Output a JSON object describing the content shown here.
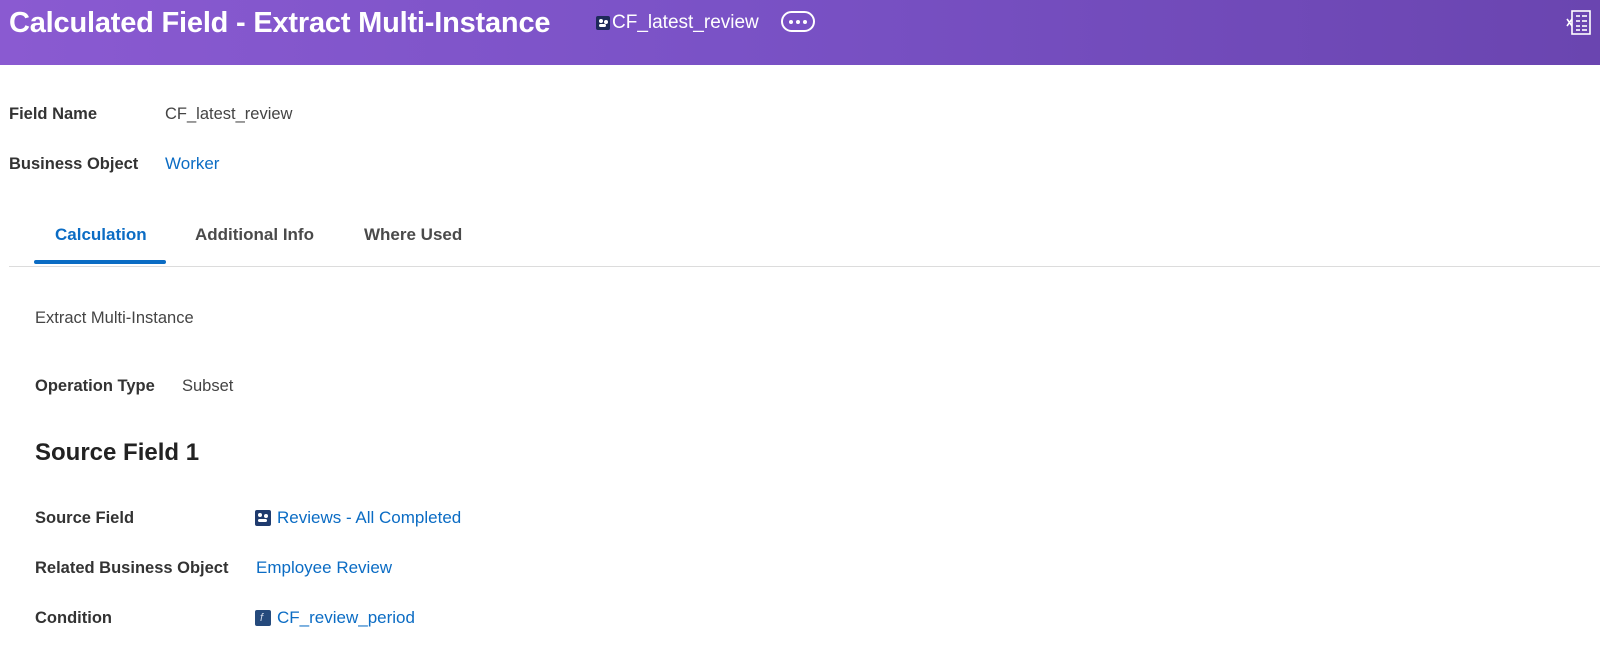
{
  "header": {
    "title": "Calculated Field - Extract Multi-Instance",
    "field_chip": "CF_latest_review",
    "more_icon": "ellipsis-icon",
    "export_icon": "excel-export-icon"
  },
  "summary": {
    "field_name_label": "Field Name",
    "field_name_value": "CF_latest_review",
    "business_object_label": "Business Object",
    "business_object_value": "Worker"
  },
  "tabs": [
    {
      "label": "Calculation",
      "active": true
    },
    {
      "label": "Additional Info",
      "active": false
    },
    {
      "label": "Where Used",
      "active": false
    }
  ],
  "calculation": {
    "type_text": "Extract Multi-Instance",
    "operation_type_label": "Operation Type",
    "operation_type_value": "Subset",
    "section_title": "Source Field 1",
    "source_field_label": "Source Field",
    "source_field_value": "Reviews - All Completed",
    "related_bo_label": "Related Business Object",
    "related_bo_value": "Employee Review",
    "condition_label": "Condition",
    "condition_value": "CF_review_period"
  },
  "colors": {
    "header_start": "#8a5ad1",
    "header_end": "#6a45b0",
    "link": "#0b6cc4",
    "tab_active": "#0b6cc4"
  }
}
